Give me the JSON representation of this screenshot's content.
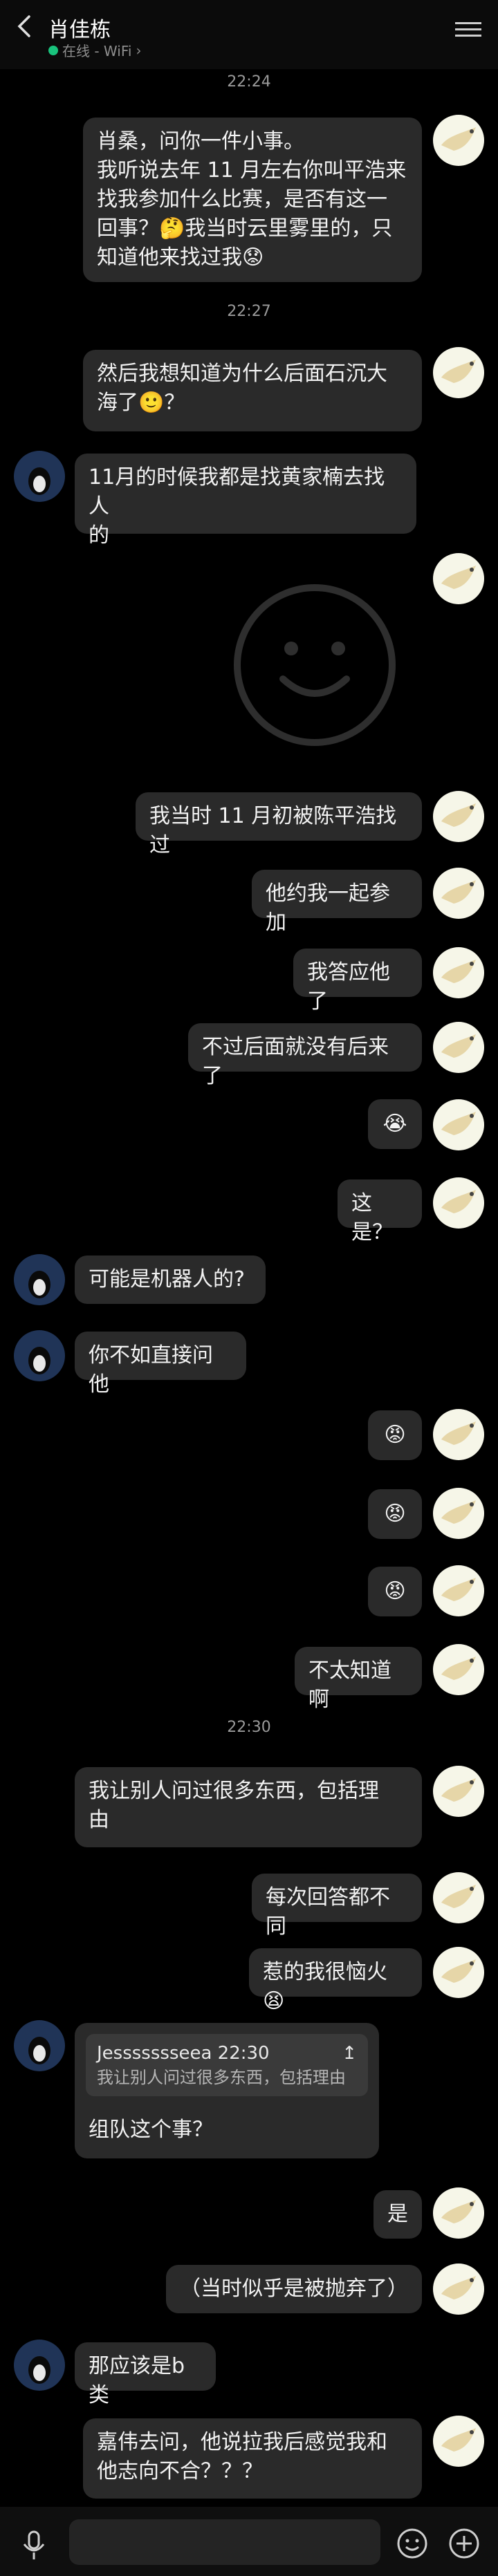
{
  "header": {
    "title": "肖佳栋",
    "status": "在线 - WiFi",
    "chevron": "›",
    "status_color": "#19c37d"
  },
  "timestamps": [
    "22:24",
    "22:27",
    "22:30"
  ],
  "messages": {
    "m1": "肖桑，问你一件小事。\n我听说去年 11 月左右你叫平浩来\n找我参加什么比赛，是否有这一\n回事？🤔我当时云里雾里的，只\n知道他来找过我😟",
    "m2": "然后我想知道为什么后面石沉大\n海了🙂？",
    "m3": "11月的时候我都是找黄家楠去找人\n的",
    "m4": "我当时 11 月初被陈平浩找过",
    "m5": "他约我一起参加",
    "m6": "我答应他了",
    "m7": "不过后面就没有后来了",
    "m8": "😭",
    "m9": "这是？",
    "m10": "可能是机器人的?",
    "m11": "你不如直接问他",
    "m12": "😡",
    "m13": "😡",
    "m14": "😡",
    "m15": "不太知道啊",
    "m16": "我让别人问过很多东西，包括理\n由",
    "m17": "每次回答都不同",
    "m18": "惹的我很恼火😫",
    "m19": "组队这个事？",
    "m20": "是",
    "m21": "（当时似乎是被抛弃了）",
    "m22": "那应该是b类",
    "m23": "嘉伟去问，他说拉我后感觉我和\n他志向不合？？？"
  },
  "quote": {
    "header": "Jessssssseea 22:30",
    "icon": "↥",
    "text": "我让别人问过很多东西，包括理由"
  },
  "colors": {
    "bubble": "#2a2a2a",
    "background": "#000000",
    "accent_online": "#19c37d"
  }
}
